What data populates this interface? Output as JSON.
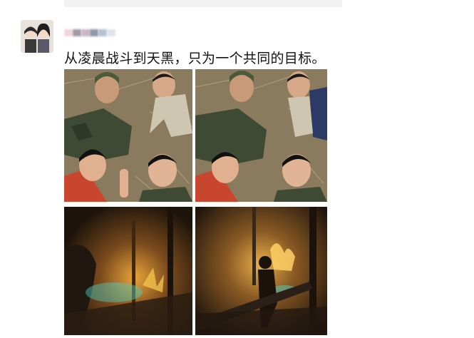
{
  "post": {
    "text": "从凌晨战斗到天黑，只为一个共同的目标。",
    "name_blur_colors": [
      "#f0d6dc",
      "#a49aa6",
      "#c9b8c4",
      "#8e98a8",
      "#b3c0d0",
      "#dfe3ea"
    ]
  },
  "photos": [
    {
      "id": "selfie-1",
      "subject": "firefighters-selfie"
    },
    {
      "id": "selfie-2",
      "subject": "firefighters-selfie"
    },
    {
      "id": "fire-1",
      "subject": "night-forest-fire"
    },
    {
      "id": "fire-2",
      "subject": "night-forest-fire"
    }
  ],
  "colors": {
    "text": "#111111",
    "ground": "#8a7a5e",
    "uniform": "#3e4a33",
    "shirt_red": "#c9462e",
    "fire_glow": "#e8a43a",
    "night": "#2a1d12"
  }
}
